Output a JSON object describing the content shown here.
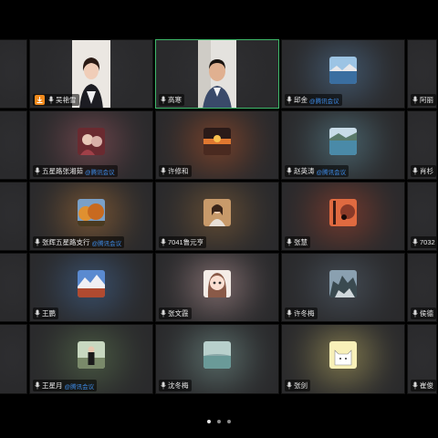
{
  "meeting": {
    "app_label": "腾讯会议",
    "pager": {
      "total": 3,
      "current": 1
    }
  },
  "participants": [
    {
      "name": "",
      "col": 0,
      "row": 0,
      "type": "cut"
    },
    {
      "name": "吴艳雪",
      "share": true,
      "type": "video-female",
      "bg": "#e8e6e3"
    },
    {
      "name": "高寒",
      "type": "video-male",
      "bg": "#e2e0dc",
      "active": true
    },
    {
      "name": "邱金",
      "sub": "@腾讯会议",
      "type": "avatar",
      "avatar": "lake",
      "tint": "#5a86b0"
    },
    {
      "name": "阿丽",
      "type": "cut"
    },
    {
      "name": "",
      "type": "cut"
    },
    {
      "name": "五星路张湘茹",
      "sub": "@腾讯会议",
      "type": "avatar",
      "avatar": "girl",
      "tint": "#b0606a"
    },
    {
      "name": "许修和",
      "type": "avatar",
      "avatar": "sunset",
      "tint": "#c85a2a"
    },
    {
      "name": "赵英涛",
      "sub": "@腾讯会议",
      "type": "avatar",
      "avatar": "water",
      "tint": "#6a9fb0"
    },
    {
      "name": "肖杉",
      "type": "cut"
    },
    {
      "name": "",
      "type": "cut"
    },
    {
      "name": "张辉五星路支行",
      "sub": "@腾讯会议",
      "type": "avatar",
      "avatar": "autumn",
      "tint": "#c8803a"
    },
    {
      "name": "7041鲁元亨",
      "type": "avatar",
      "avatar": "woman",
      "tint": "#a0703c"
    },
    {
      "name": "张慧",
      "type": "avatar",
      "avatar": "silhouette",
      "tint": "#c04a30"
    },
    {
      "name": "7032",
      "type": "cut"
    },
    {
      "name": "",
      "type": "cut"
    },
    {
      "name": "王鹏",
      "type": "avatar",
      "avatar": "mountain",
      "tint": "#4a78b0"
    },
    {
      "name": "张文霞",
      "type": "avatar",
      "avatar": "cartoon",
      "tint": "#d8b0b0"
    },
    {
      "name": "许冬梅",
      "type": "avatar",
      "avatar": "rocks",
      "tint": "#607080"
    },
    {
      "name": "侯德",
      "type": "cut"
    },
    {
      "name": "",
      "type": "cut"
    },
    {
      "name": "王星月",
      "sub": "@腾讯会议",
      "type": "avatar",
      "avatar": "person",
      "tint": "#6a8a5a"
    },
    {
      "name": "沈冬梅",
      "type": "avatar",
      "avatar": "sky",
      "tint": "#8ab0a8"
    },
    {
      "name": "张剑",
      "type": "avatar",
      "avatar": "cat",
      "tint": "#d8c870"
    },
    {
      "name": "崔俊",
      "type": "cut"
    }
  ]
}
